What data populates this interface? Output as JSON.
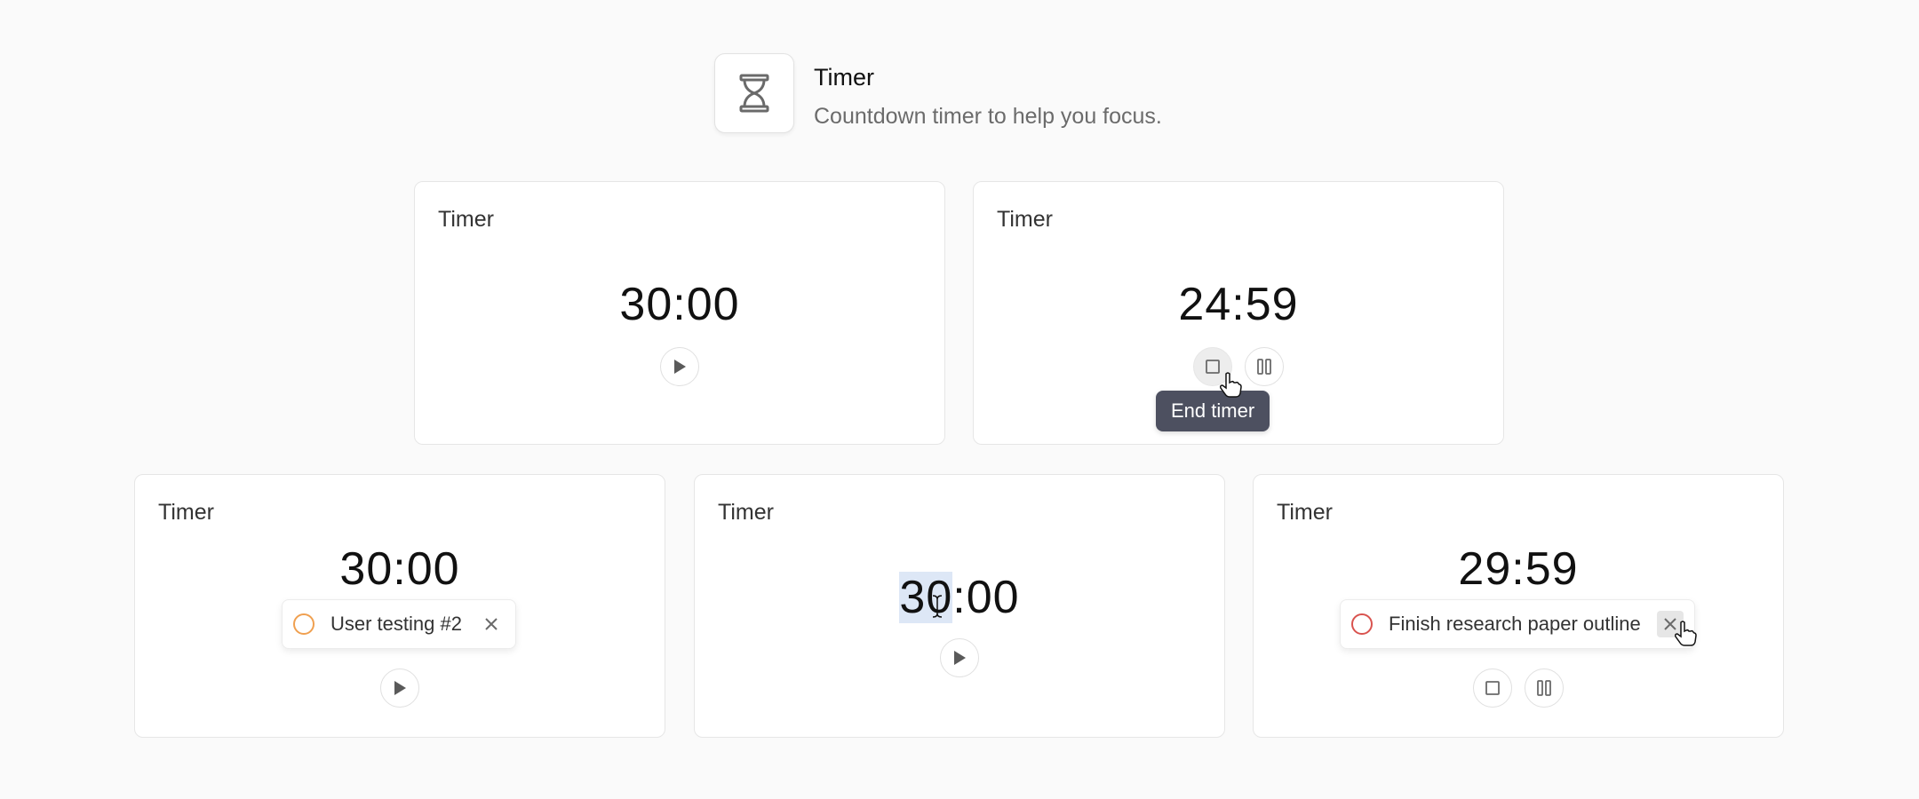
{
  "header": {
    "title": "Timer",
    "subtitle": "Countdown timer to help you focus.",
    "icon": "hourglass-icon"
  },
  "cards": [
    {
      "title": "Timer",
      "time": "30:00",
      "state": "idle"
    },
    {
      "title": "Timer",
      "time": "24:59",
      "state": "running",
      "tooltip": "End timer"
    },
    {
      "title": "Timer",
      "time": "30:00",
      "state": "idle",
      "task": {
        "label": "User testing #2",
        "color": "#f0a050"
      }
    },
    {
      "title": "Timer",
      "time_selected": "30",
      "time_rest": ":00",
      "state": "editing"
    },
    {
      "title": "Timer",
      "time": "29:59",
      "state": "running",
      "task": {
        "label": "Finish research paper outline",
        "color": "#d9534f"
      }
    }
  ],
  "colors": {
    "tooltip_bg": "#4d5060",
    "selection": "#dde7f6"
  }
}
